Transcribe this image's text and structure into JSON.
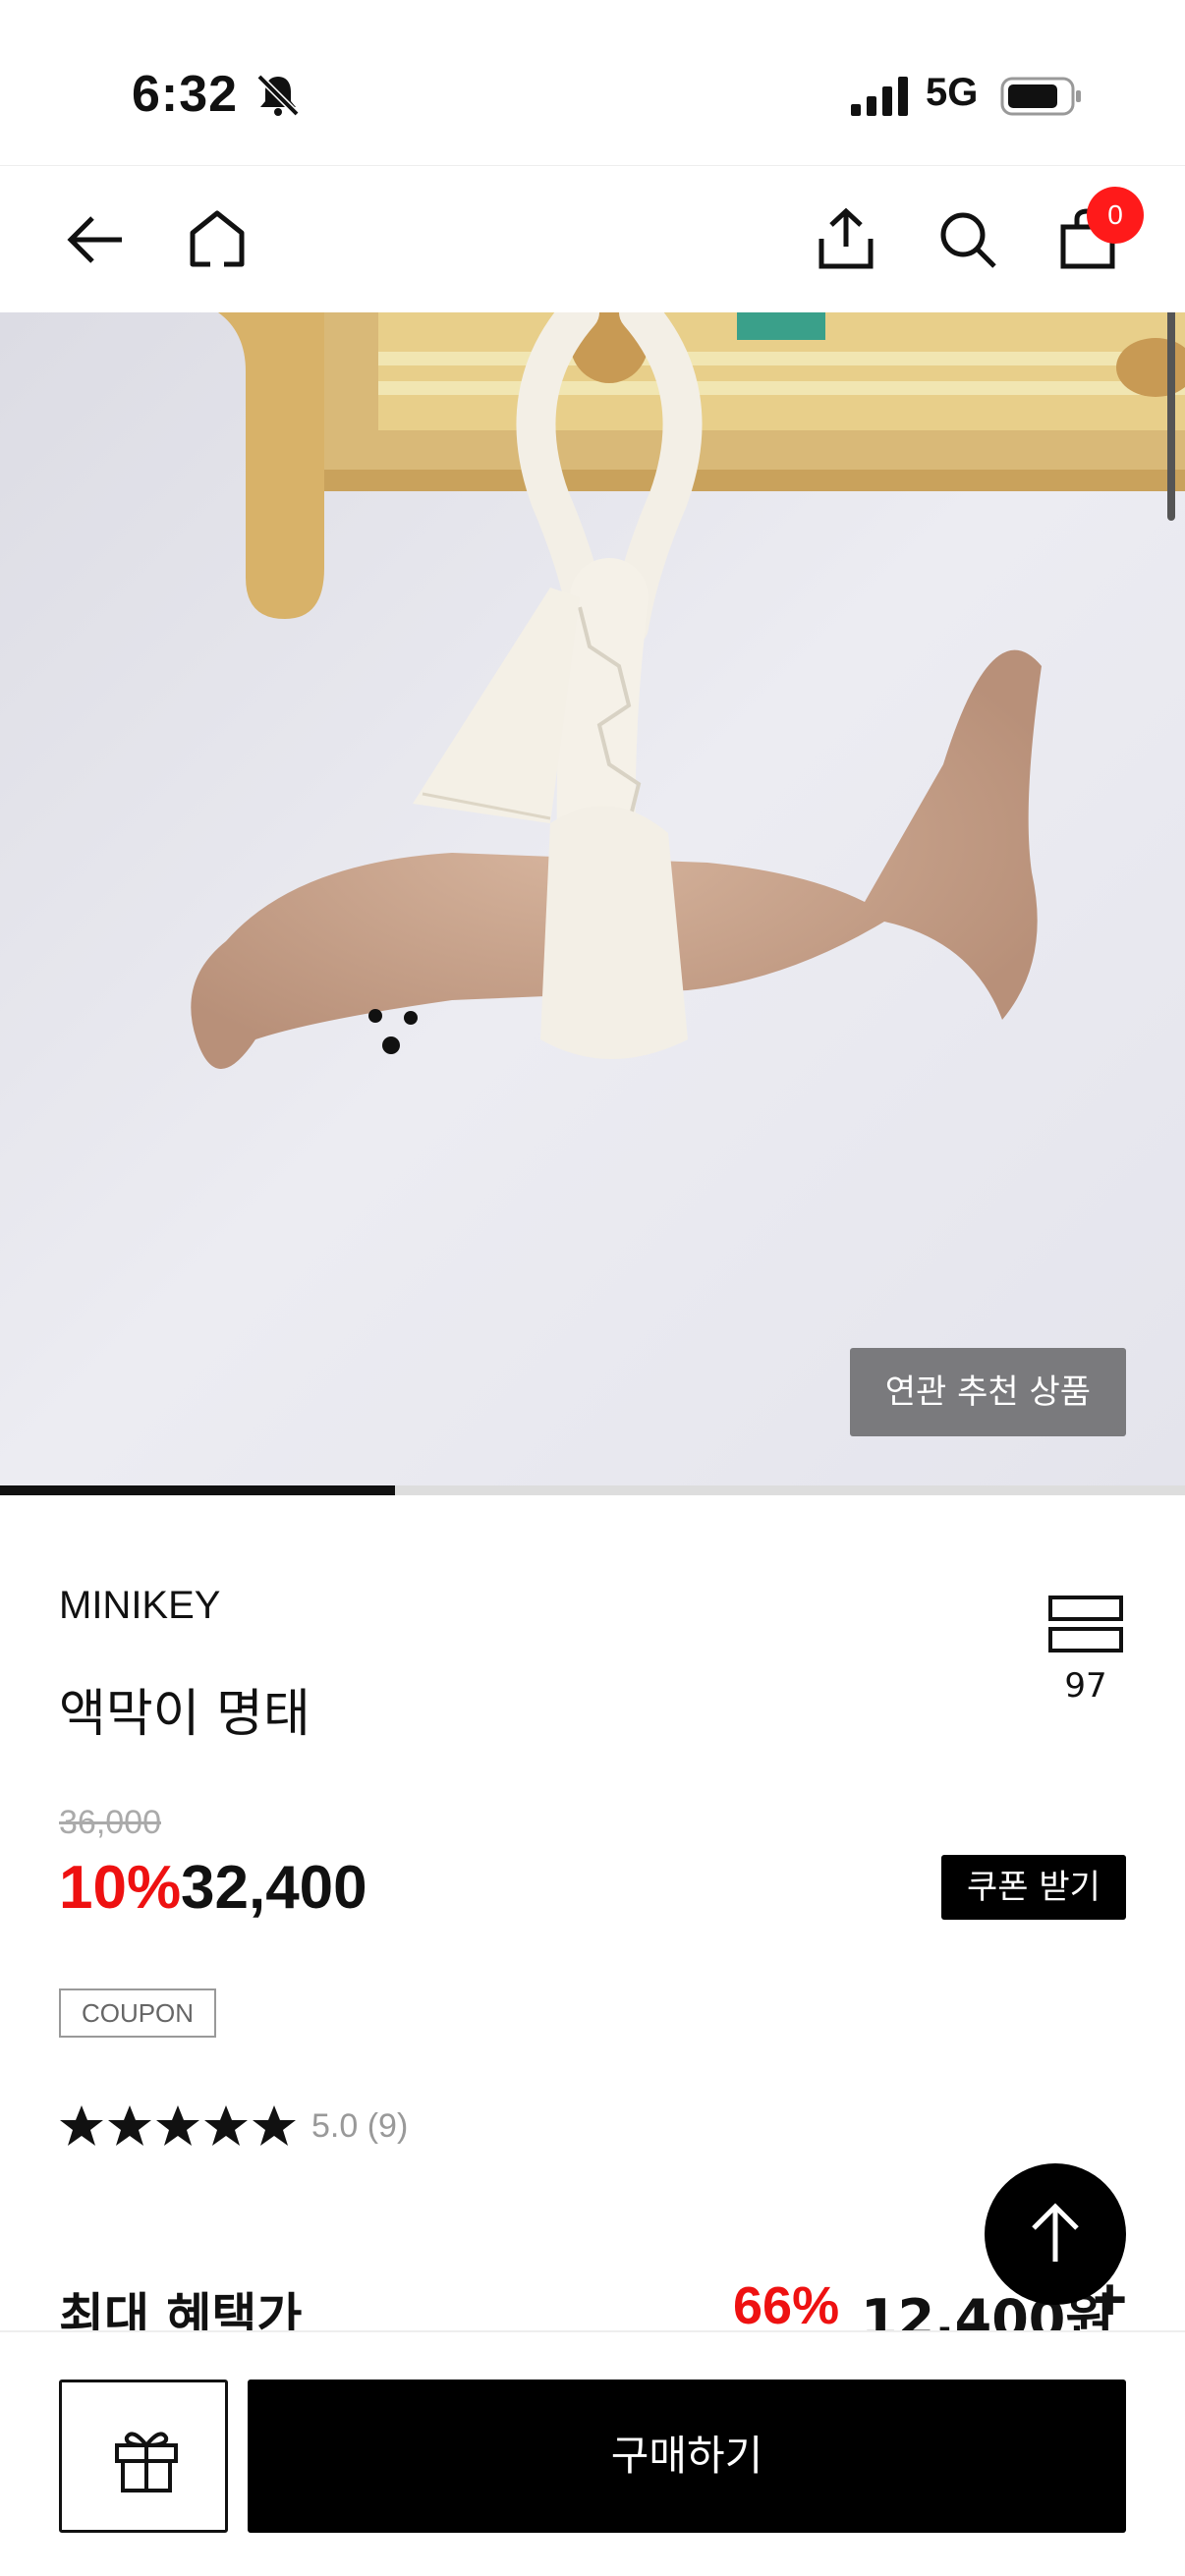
{
  "status_bar": {
    "time": "6:32",
    "network": "5G",
    "icons": [
      "bell-slash-icon",
      "signal-icon",
      "battery-icon"
    ]
  },
  "nav": {
    "icons": [
      "back-arrow-icon",
      "home-icon",
      "share-icon",
      "search-icon",
      "shopping-bag-icon"
    ],
    "cart_count": "0"
  },
  "hero": {
    "related_label": "연관 추천 상품",
    "image_progress": 0.333
  },
  "product": {
    "brand": "MINIKEY",
    "name": "액막이 명태",
    "wish_count": "97",
    "original_price": "36,000",
    "discount": "10%",
    "price": "32,400",
    "coupon_button": "쿠폰 받기",
    "coupon_tag": "COUPON",
    "rating_stars": 5,
    "rating_text": "5.0 (9)"
  },
  "max_benefit": {
    "label": "최대 혜택가",
    "discount": "66%",
    "price": "12,400원",
    "expand": "+"
  },
  "bottom_bar": {
    "buy_label": "구매하기"
  },
  "colors": {
    "accent_red": "#ee1111",
    "badge_red": "#ff1a1a",
    "primary_black": "#000000"
  }
}
